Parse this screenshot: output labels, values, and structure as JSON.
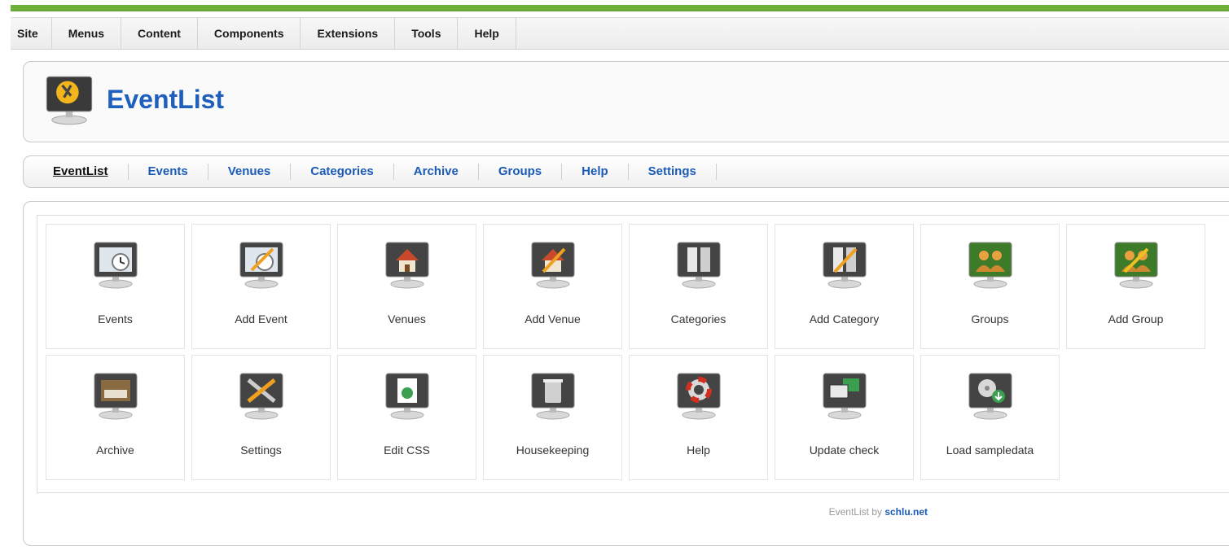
{
  "menubar": {
    "items": [
      "Site",
      "Menus",
      "Content",
      "Components",
      "Extensions",
      "Tools",
      "Help"
    ]
  },
  "header": {
    "title": "EventList",
    "icon": "eventlist-logo-icon"
  },
  "subnav": {
    "items": [
      "EventList",
      "Events",
      "Venues",
      "Categories",
      "Archive",
      "Groups",
      "Help",
      "Settings"
    ],
    "active": "EventList"
  },
  "tiles": [
    {
      "label": "Events",
      "icon": "events-icon"
    },
    {
      "label": "Add Event",
      "icon": "add-event-icon"
    },
    {
      "label": "Venues",
      "icon": "venues-icon"
    },
    {
      "label": "Add Venue",
      "icon": "add-venue-icon"
    },
    {
      "label": "Categories",
      "icon": "categories-icon"
    },
    {
      "label": "Add Category",
      "icon": "add-category-icon"
    },
    {
      "label": "Groups",
      "icon": "groups-icon"
    },
    {
      "label": "Add Group",
      "icon": "add-group-icon"
    },
    {
      "label": "Archive",
      "icon": "archive-icon"
    },
    {
      "label": "Settings",
      "icon": "settings-icon"
    },
    {
      "label": "Edit CSS",
      "icon": "edit-css-icon"
    },
    {
      "label": "Housekeeping",
      "icon": "housekeeping-icon"
    },
    {
      "label": "Help",
      "icon": "help-icon"
    },
    {
      "label": "Update check",
      "icon": "update-check-icon"
    },
    {
      "label": "Load sampledata",
      "icon": "load-sampledata-icon"
    }
  ],
  "footer": {
    "prefix": "EventList by",
    "link": "schlu.net"
  },
  "colors": {
    "accent": "#6fb03a",
    "link": "#1a5bb8",
    "title": "#1f5fbd"
  }
}
